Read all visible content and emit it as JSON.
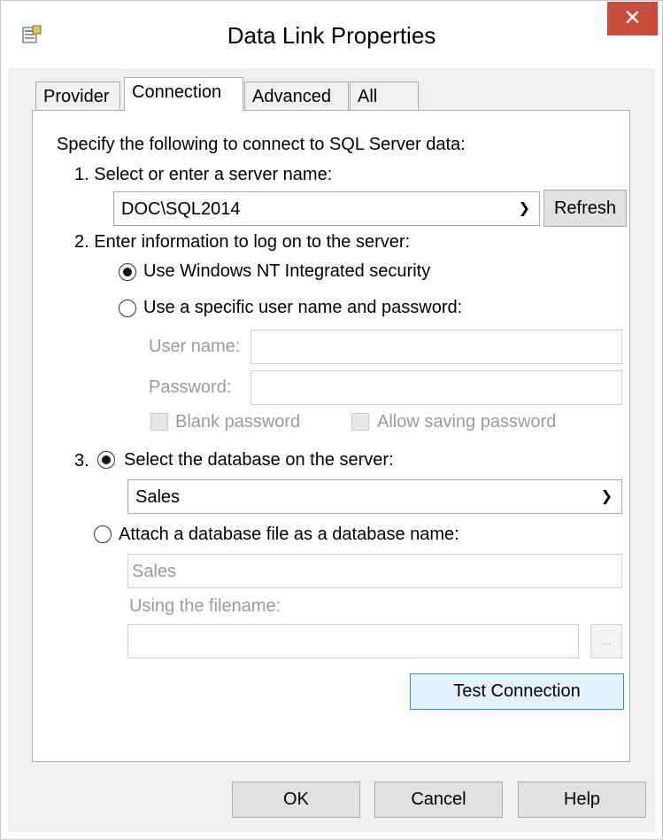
{
  "window": {
    "title": "Data Link Properties",
    "close_glyph": "✕",
    "icon": "data-link-icon"
  },
  "tabs": [
    {
      "label": "Provider",
      "active": false
    },
    {
      "label": "Connection",
      "active": true
    },
    {
      "label": "Advanced",
      "active": false
    },
    {
      "label": "All",
      "active": false
    }
  ],
  "connection": {
    "intro": "Specify the following to connect to SQL Server data:",
    "step1_label": "1. Select or enter a server name:",
    "server_value": "DOC\\SQL2014",
    "refresh_label": "Refresh",
    "step2_label": "2. Enter information to log on to the server:",
    "radio_windows_label": "Use Windows NT Integrated security",
    "radio_specific_label": "Use a specific user name and password:",
    "username_label": "User name:",
    "username_value": "",
    "password_label": "Password:",
    "password_value": "",
    "blank_password_label": "Blank password",
    "allow_saving_label": "Allow saving password",
    "step3_prefix": "3.",
    "radio_select_db_label": "Select the database on the server:",
    "database_value": "Sales",
    "radio_attach_label": "Attach a database file as a database name:",
    "attach_name_value": "Sales",
    "using_filename_label": "Using the filename:",
    "filename_value": "",
    "browse_label": "...",
    "test_connection_label": "Test Connection"
  },
  "footer": {
    "ok_label": "OK",
    "cancel_label": "Cancel",
    "help_label": "Help"
  },
  "colors": {
    "close_button": "#c94b3e",
    "focus_border": "#2f8ee0"
  }
}
